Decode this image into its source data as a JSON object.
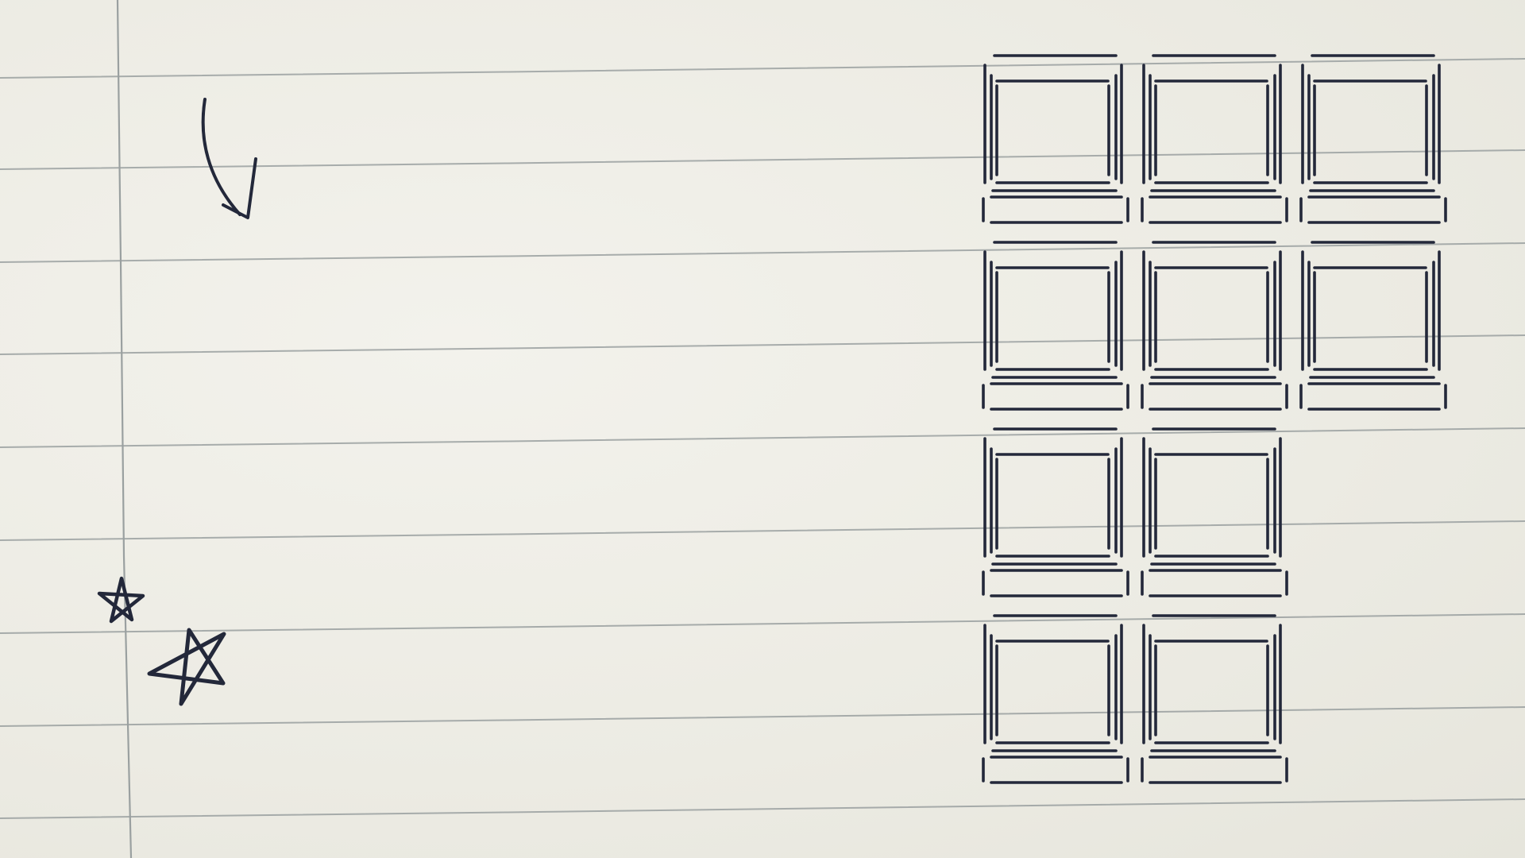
{
  "page": {
    "kind": "notebook-paper-sketch",
    "paper_color": "#efefe7",
    "rule_color": "#9aa0a0",
    "ink_color": "#23283a"
  },
  "doodles": [
    {
      "name": "curved-arrow-icon",
      "icon": "curved-arrow-down"
    },
    {
      "name": "small-star-icon",
      "icon": "star"
    },
    {
      "name": "large-star-icon",
      "icon": "star"
    }
  ],
  "window_sketch": {
    "description_icon": "window-pane-grid",
    "rows": [
      3,
      3,
      2,
      2
    ]
  }
}
